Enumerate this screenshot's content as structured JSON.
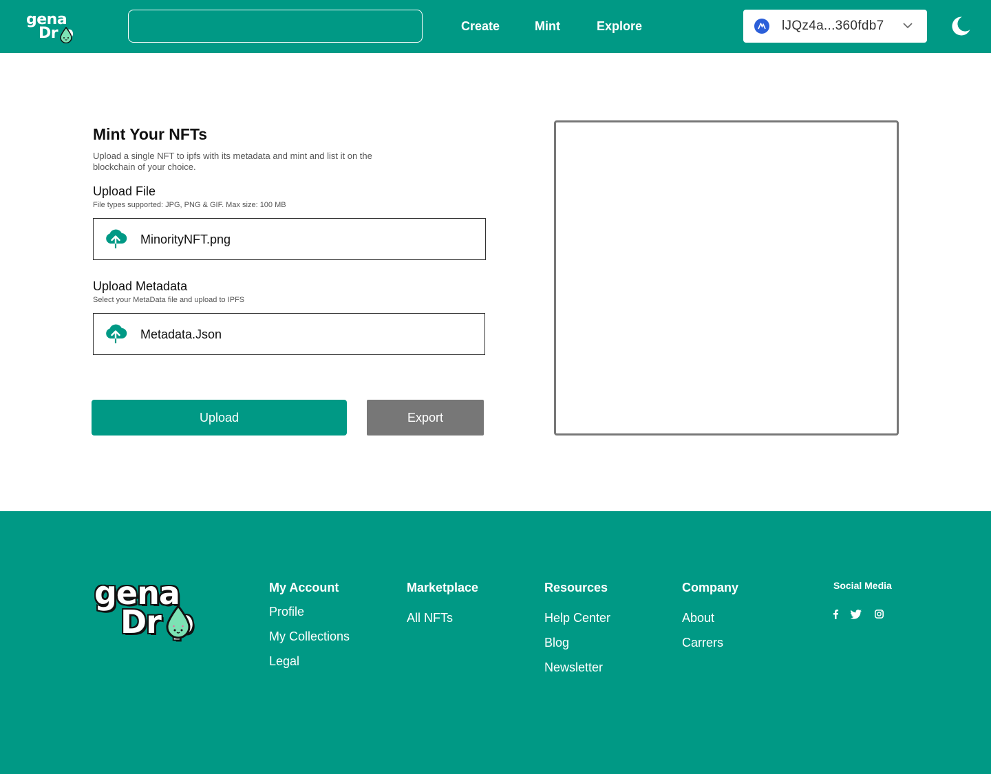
{
  "header": {
    "logo_line1": "gena",
    "logo_line2": "Dr  p",
    "search_placeholder": "",
    "nav": [
      "Create",
      "Mint",
      "Explore"
    ],
    "wallet_address": "lJQz4a...360fdb7",
    "wallet_chain_icon": "algorand-icon",
    "theme_icon": "moon-icon"
  },
  "main": {
    "title": "Mint Your NFTs",
    "description": "Upload a single NFT to ipfs with its metadata and mint and list it on the blockchain of your choice.",
    "upload_file": {
      "label": "Upload File",
      "hint": "File types supported: JPG, PNG & GIF. Max size: 100 MB",
      "filename": "MinorityNFT.png"
    },
    "upload_metadata": {
      "label": "Upload Metadata",
      "hint": "Select your MetaData file and upload to IPFS",
      "filename": "Metadata.Json"
    },
    "upload_button": "Upload",
    "export_button": "Export"
  },
  "footer": {
    "logo_line1": "gena",
    "logo_line2": "Dr  p",
    "columns": [
      {
        "heading": "My Account",
        "links": [
          "Profile",
          "My Collections",
          "Legal"
        ]
      },
      {
        "heading": "Marketplace",
        "links": [
          "All NFTs"
        ]
      },
      {
        "heading": "Resources",
        "links": [
          "Help Center",
          "Blog",
          "Newsletter"
        ]
      },
      {
        "heading": "Company",
        "links": [
          "About",
          "Carrers"
        ]
      }
    ],
    "social_heading": "Social Media",
    "social_icons": [
      "facebook-icon",
      "twitter-icon",
      "instagram-icon"
    ]
  },
  "colors": {
    "brand": "#009985",
    "export_button": "#777777",
    "drop": "#7ce2b4"
  }
}
